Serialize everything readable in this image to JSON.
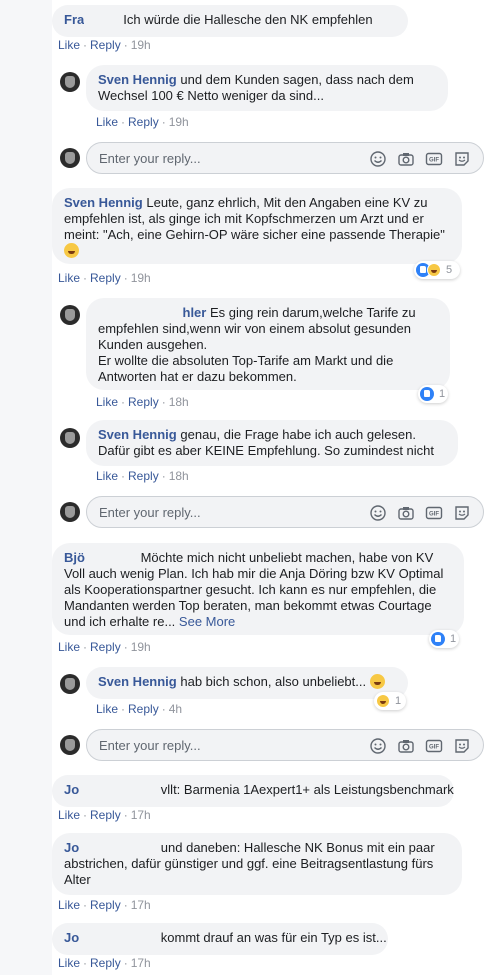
{
  "actions": {
    "like": "Like",
    "reply": "Reply",
    "see_more": "See More"
  },
  "reply_placeholder": "Enter your reply...",
  "icons": [
    "emoji-icon",
    "camera-icon",
    "gif-icon",
    "sticker-icon"
  ],
  "comments": [
    {
      "author": "Fra",
      "text": "Ich würde die Hallesche den NK empfehlen",
      "time": "19h"
    },
    {
      "author": "Sven Hennig",
      "text": "und dem Kunden sagen, dass nach dem Wechsel 100 € Netto weniger da sind...",
      "time": "19h"
    },
    {
      "author": "Sven Hennig",
      "text": "Leute, ganz ehrlich, Mit den Angaben eine KV zu empfehlen ist, als ginge ich mit Kopfschmerzen um Arzt und er meint: \"Ach, eine Gehirn-OP wäre sicher eine passende Therapie\"",
      "time": "19h",
      "reactions": "5"
    },
    {
      "author": "hler",
      "text": "Es ging rein darum,welche Tarife zu empfehlen sind,wenn wir von einem absolut gesunden Kunden ausgehen.",
      "text2": "Er wollte die absoluten Top-Tarife am Markt und die Antworten hat er dazu bekommen.",
      "time": "18h",
      "reactions": "1"
    },
    {
      "author": "Sven Hennig",
      "text": "genau, die Frage habe ich auch gelesen. Dafür gibt es aber KEINE Empfehlung. So zumindest nicht",
      "time": "18h"
    },
    {
      "author": "Bjö",
      "text": "Möchte mich nicht unbeliebt machen, habe von KV Voll auch wenig Plan. Ich hab mir die Anja Döring bzw KV Optimal als Kooperationspartner gesucht. Ich kann es nur empfehlen, die Mandanten werden Top beraten, man bekommt etwas Courtage und ich erhalte re...",
      "time": "19h",
      "reactions": "1"
    },
    {
      "author": "Sven Hennig",
      "text": "hab bich schon, also unbeliebt...",
      "time": "4h",
      "reactions": "1"
    },
    {
      "author": "Jo",
      "text": "vllt: Barmenia 1Aexpert1+ als Leistungsbenchmark",
      "time": "17h"
    },
    {
      "author": "Jo",
      "text": "und daneben: Hallesche NK Bonus mit ein paar abstrichen, dafür günstiger und ggf. eine Beitragsentlastung fürs Alter",
      "time": "17h"
    },
    {
      "author": "Jo",
      "text": "kommt drauf an was für ein Typ es ist...",
      "time": "17h"
    }
  ]
}
